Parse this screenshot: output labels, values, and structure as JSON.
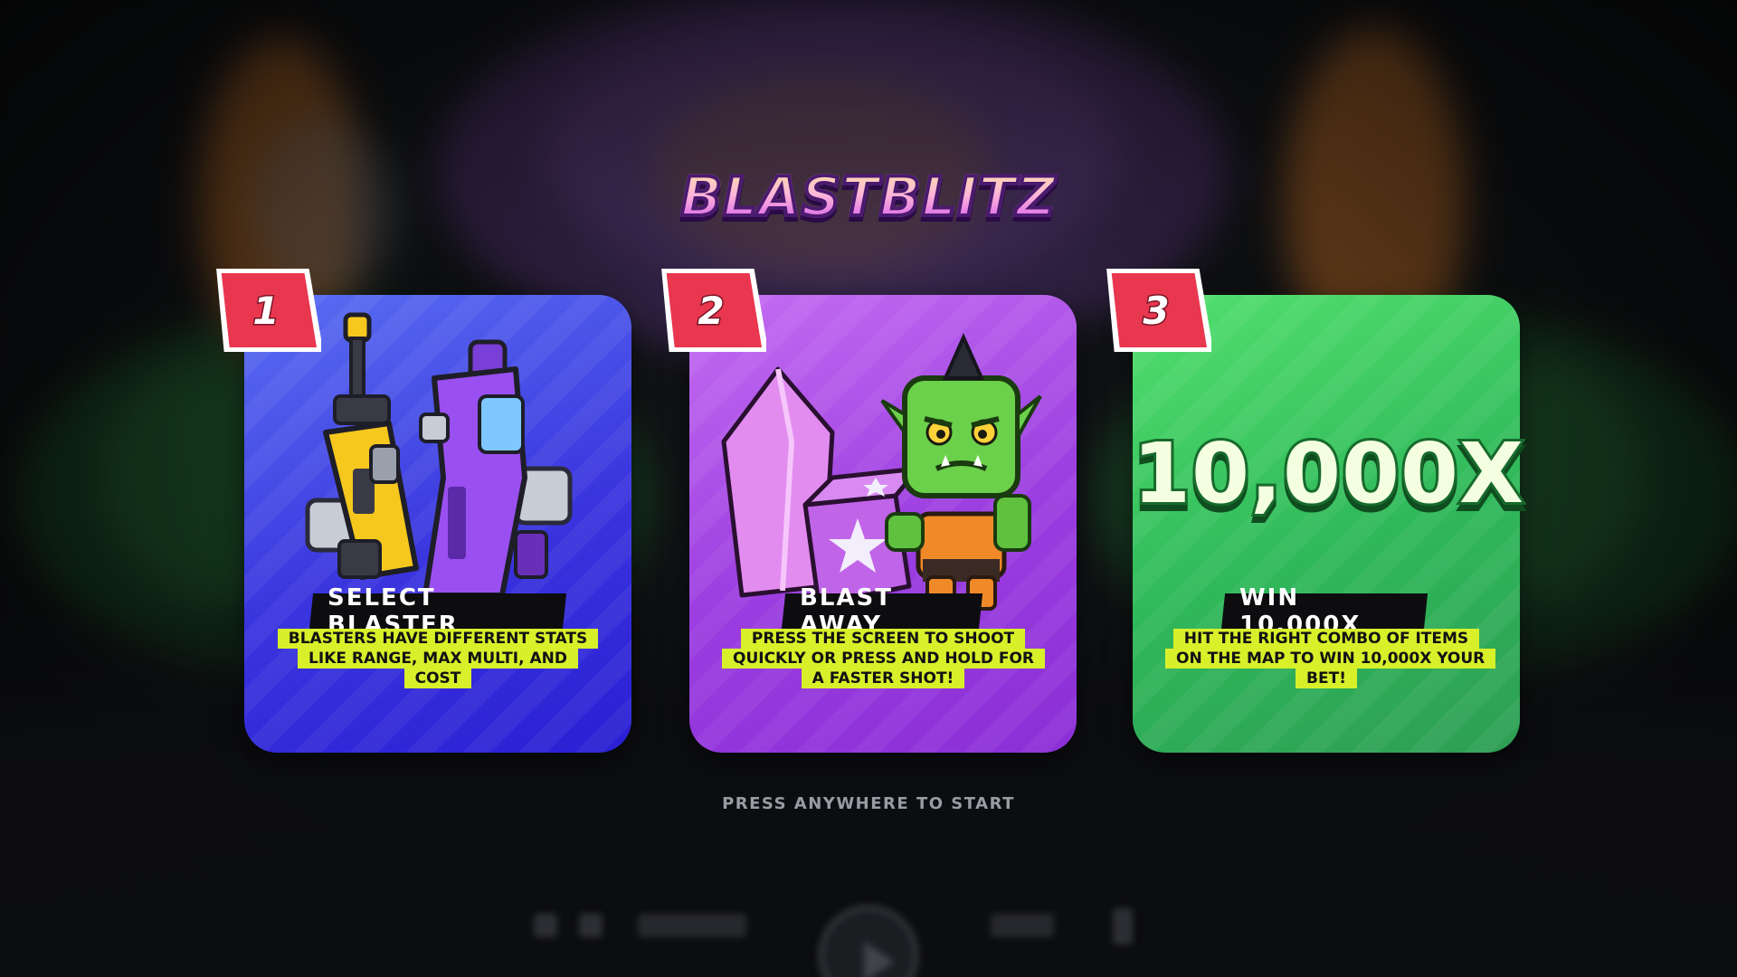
{
  "game": {
    "logo": "BLASTBLITZ"
  },
  "cards": [
    {
      "number": "1",
      "title": "SELECT BLASTER",
      "description": "BLASTERS HAVE DIFFERENT STATS LIKE RANGE, MAX MULTI, AND COST",
      "color": "#3a35de"
    },
    {
      "number": "2",
      "title": "BLAST AWAY",
      "description": "PRESS THE SCREEN TO SHOOT QUICKLY OR PRESS AND HOLD FOR A FASTER SHOT!",
      "color": "#9b3de0"
    },
    {
      "number": "3",
      "title": "WIN 10,000X",
      "description": "HIT THE RIGHT COMBO OF ITEMS ON THE MAP TO WIN 10,000X YOUR BET!",
      "multiplier": "10,000X",
      "color": "#2fb85a"
    }
  ],
  "prompt": "PRESS ANYWHERE TO START",
  "colors": {
    "badge": "#e8374f",
    "highlight": "#d8f02a",
    "title_bg": "#0d0d10"
  }
}
